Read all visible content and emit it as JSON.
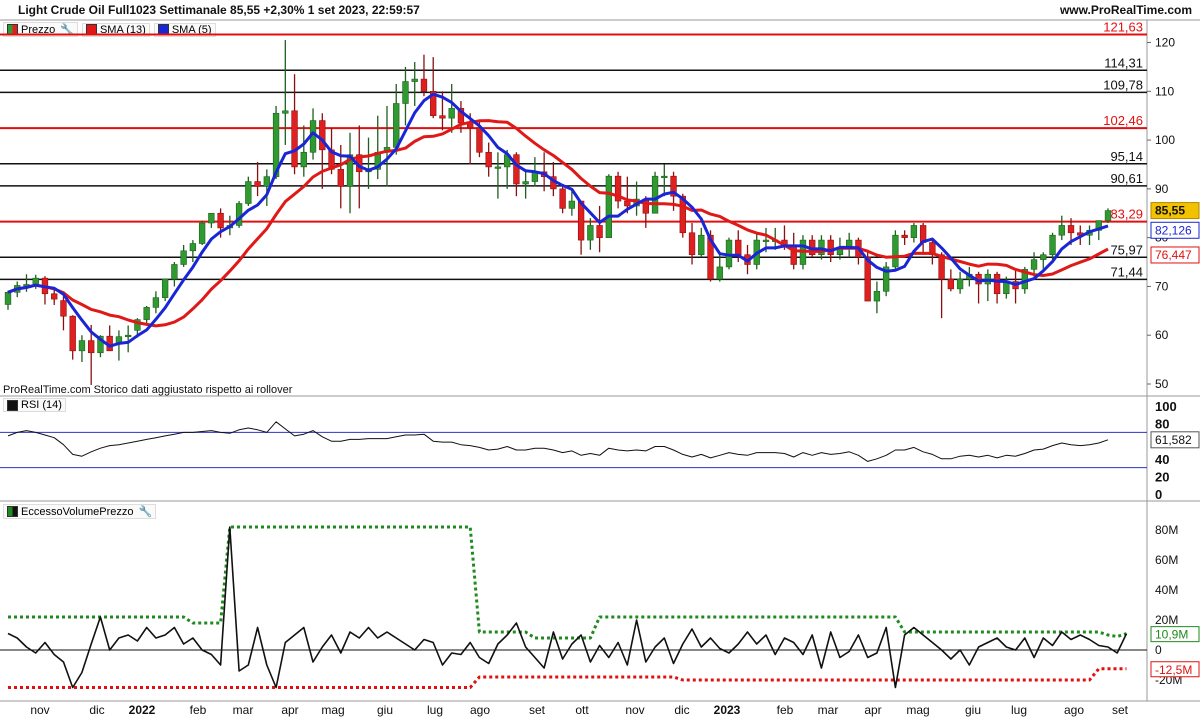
{
  "header": {
    "title": "Light Crude Oil Full1023 Settimanale 85,55 +2,30% 1 set 2023, 22:59:57",
    "site": "www.ProRealTime.com"
  },
  "legend": {
    "price_label": "Prezzo",
    "sma13_label": "SMA (13)",
    "sma5_label": "SMA (5)",
    "rsi_label": "RSI (14)",
    "volume_label": "EccessoVolumePrezzo"
  },
  "footnote": "ProRealTime.com  Storico dati aggiustato rispetto ai rollover",
  "colors": {
    "up": "#2f9a2f",
    "down": "#e02020",
    "sma13": "#e01818",
    "sma5": "#1a25d6",
    "red_level": "#e01010",
    "black_level": "#111111",
    "price_badge": "#f2c200",
    "green_dotted": "#1f8a1f",
    "red_dotted": "#e01010"
  },
  "chart_data": [
    {
      "type": "candlestick",
      "name": "Light Crude Oil Full1023 Settimanale",
      "ylim": [
        50,
        124
      ],
      "y_ticks": [
        50,
        60,
        70,
        80,
        90,
        100,
        110,
        120
      ],
      "x_tick_labels": [
        "nov",
        "dic",
        "2022",
        "feb",
        "mar",
        "apr",
        "mag",
        "giu",
        "lug",
        "ago",
        "set",
        "ott",
        "nov",
        "dic",
        "2023",
        "feb",
        "mar",
        "apr",
        "mag",
        "giu",
        "lug",
        "ago",
        "set"
      ],
      "levels": [
        {
          "value": 121.63,
          "label": "121,63",
          "color": "red"
        },
        {
          "value": 114.31,
          "label": "114,31",
          "color": "black"
        },
        {
          "value": 109.78,
          "label": "109,78",
          "color": "black"
        },
        {
          "value": 102.46,
          "label": "102,46",
          "color": "red"
        },
        {
          "value": 95.14,
          "label": "95,14",
          "color": "black"
        },
        {
          "value": 90.61,
          "label": "90,61",
          "color": "black"
        },
        {
          "value": 83.29,
          "label": "83,29",
          "color": "red"
        },
        {
          "value": 75.97,
          "label": "75,97",
          "color": "black"
        },
        {
          "value": 71.44,
          "label": "71,44",
          "color": "black"
        }
      ],
      "last_price": "85,55",
      "sma5_last": "82,126",
      "sma13_last": "76,447",
      "candles": [
        [
          66.3,
          69.1,
          65.2,
          68.8
        ],
        [
          68.8,
          71.0,
          67.8,
          70.2
        ],
        [
          70.2,
          72.5,
          68.9,
          70.4
        ],
        [
          70.4,
          72.4,
          69.5,
          71.7
        ],
        [
          71.7,
          72.1,
          66.3,
          68.5
        ],
        [
          68.5,
          69.5,
          66.2,
          67.4
        ],
        [
          67.1,
          68.0,
          61.0,
          63.9
        ],
        [
          63.9,
          64.1,
          55.0,
          56.8
        ],
        [
          56.8,
          60.0,
          54.5,
          58.9
        ],
        [
          58.9,
          62.1,
          49.8,
          56.4
        ],
        [
          56.4,
          60.0,
          55.5,
          59.8
        ],
        [
          59.8,
          62.0,
          57.8,
          56.8
        ],
        [
          58.2,
          61.0,
          54.8,
          59.7
        ],
        [
          59.7,
          62.0,
          56.5,
          60.0
        ],
        [
          61.0,
          63.5,
          59.5,
          63.2
        ],
        [
          63.2,
          66.0,
          62.5,
          65.7
        ],
        [
          65.7,
          69.0,
          64.5,
          67.7
        ],
        [
          67.7,
          71.5,
          67.0,
          71.5
        ],
        [
          71.5,
          75.0,
          70.0,
          74.5
        ],
        [
          74.5,
          78.5,
          74.0,
          77.3
        ],
        [
          77.3,
          79.5,
          75.0,
          78.8
        ],
        [
          78.8,
          83.5,
          78.5,
          83.0
        ],
        [
          83.0,
          85.0,
          82.0,
          85.0
        ],
        [
          85.0,
          86.0,
          80.0,
          82.0
        ],
        [
          82.0,
          84.5,
          80.5,
          82.5
        ],
        [
          82.5,
          87.5,
          82.0,
          87.0
        ],
        [
          87.0,
          92.5,
          86.5,
          91.5
        ],
        [
          91.5,
          95.5,
          88.5,
          90.5
        ],
        [
          90.5,
          94.0,
          86.5,
          92.5
        ],
        [
          92.5,
          107.0,
          92.0,
          105.5
        ],
        [
          105.5,
          120.5,
          99.0,
          106.0
        ],
        [
          106.0,
          113.5,
          93.0,
          94.5
        ],
        [
          94.5,
          103.0,
          92.5,
          97.5
        ],
        [
          97.5,
          106.5,
          96.0,
          104.0
        ],
        [
          104.0,
          105.5,
          90.0,
          98.0
        ],
        [
          98.0,
          102.5,
          93.0,
          94.0
        ],
        [
          94.0,
          99.0,
          86.0,
          90.5
        ],
        [
          90.5,
          101.5,
          85.0,
          97.0
        ],
        [
          97.0,
          103.0,
          86.0,
          93.5
        ],
        [
          93.5,
          100.5,
          90.0,
          94.0
        ],
        [
          94.0,
          105.0,
          92.0,
          97.5
        ],
        [
          97.5,
          107.0,
          90.5,
          98.5
        ],
        [
          98.5,
          111.5,
          97.0,
          107.5
        ],
        [
          107.5,
          115.0,
          103.0,
          112.0
        ],
        [
          112.0,
          116.0,
          107.0,
          112.5
        ],
        [
          112.5,
          117.5,
          109.0,
          110.0
        ],
        [
          110.0,
          117.0,
          104.5,
          105.0
        ],
        [
          105.0,
          110.0,
          102.0,
          104.5
        ],
        [
          104.5,
          111.5,
          101.5,
          106.5
        ],
        [
          106.5,
          108.0,
          101.5,
          103.5
        ],
        [
          103.5,
          105.5,
          95.0,
          102.5
        ],
        [
          102.5,
          104.0,
          96.5,
          97.5
        ],
        [
          97.5,
          99.5,
          92.5,
          94.5
        ],
        [
          94.5,
          97.5,
          88.0,
          94.5
        ],
        [
          94.5,
          98.0,
          90.0,
          97.0
        ],
        [
          97.0,
          97.5,
          88.5,
          91.0
        ],
        [
          91.0,
          94.0,
          88.0,
          91.5
        ],
        [
          91.5,
          96.5,
          90.5,
          93.5
        ],
        [
          93.5,
          97.5,
          89.5,
          92.5
        ],
        [
          92.5,
          95.5,
          88.5,
          90.0
        ],
        [
          90.0,
          91.0,
          85.0,
          86.0
        ],
        [
          86.0,
          89.5,
          84.5,
          87.5
        ],
        [
          87.5,
          87.5,
          76.5,
          79.5
        ],
        [
          79.5,
          84.0,
          77.5,
          82.5
        ],
        [
          82.5,
          86.5,
          77.0,
          80.0
        ],
        [
          80.0,
          93.0,
          80.0,
          92.6
        ],
        [
          92.6,
          93.5,
          86.0,
          87.5
        ],
        [
          87.5,
          92.5,
          85.0,
          86.5
        ],
        [
          86.5,
          91.5,
          84.5,
          87.9
        ],
        [
          87.9,
          88.5,
          82.0,
          85.0
        ],
        [
          85.0,
          93.5,
          85.0,
          92.6
        ],
        [
          92.6,
          95.0,
          88.5,
          92.6
        ],
        [
          92.6,
          93.5,
          85.5,
          88.5
        ],
        [
          88.5,
          89.0,
          80.0,
          81.0
        ],
        [
          81.0,
          83.0,
          74.5,
          76.5
        ],
        [
          76.5,
          82.0,
          76.0,
          80.5
        ],
        [
          80.5,
          81.5,
          71.0,
          71.5
        ],
        [
          71.5,
          77.0,
          71.0,
          74.0
        ],
        [
          74.0,
          80.0,
          73.5,
          79.5
        ],
        [
          79.5,
          81.5,
          75.0,
          76.5
        ],
        [
          76.5,
          78.5,
          72.5,
          74.5
        ],
        [
          74.5,
          81.0,
          73.5,
          79.5
        ],
        [
          79.5,
          82.0,
          77.0,
          79.5
        ],
        [
          79.5,
          82.0,
          77.5,
          79.5
        ],
        [
          79.5,
          82.5,
          77.5,
          78.5
        ],
        [
          78.5,
          81.0,
          73.5,
          74.5
        ],
        [
          74.5,
          80.5,
          73.5,
          79.5
        ],
        [
          79.5,
          80.5,
          76.0,
          76.5
        ],
        [
          76.5,
          80.5,
          75.5,
          79.5
        ],
        [
          79.5,
          80.5,
          75.0,
          76.5
        ],
        [
          76.5,
          80.0,
          75.5,
          78.0
        ],
        [
          78.0,
          81.0,
          76.0,
          79.5
        ],
        [
          79.5,
          80.0,
          74.5,
          76.0
        ],
        [
          76.0,
          77.5,
          67.5,
          67.0
        ],
        [
          67.0,
          71.0,
          64.5,
          69.0
        ],
        [
          69.0,
          75.0,
          68.0,
          74.0
        ],
        [
          74.0,
          81.5,
          73.5,
          80.5
        ],
        [
          80.5,
          81.5,
          78.5,
          80.0
        ],
        [
          80.0,
          83.0,
          79.0,
          82.5
        ],
        [
          82.5,
          83.0,
          76.5,
          79.0
        ],
        [
          79.0,
          80.0,
          74.5,
          76.5
        ],
        [
          76.5,
          77.0,
          63.5,
          71.5
        ],
        [
          71.5,
          73.5,
          69.0,
          69.5
        ],
        [
          69.5,
          73.0,
          68.5,
          71.5
        ],
        [
          71.5,
          74.0,
          70.0,
          72.5
        ],
        [
          72.5,
          73.0,
          66.5,
          70.5
        ],
        [
          70.5,
          73.5,
          67.0,
          72.5
        ],
        [
          72.5,
          73.0,
          66.5,
          68.5
        ],
        [
          68.5,
          72.0,
          67.5,
          71.0
        ],
        [
          71.0,
          73.5,
          66.5,
          69.5
        ],
        [
          69.5,
          74.0,
          68.5,
          73.5
        ],
        [
          73.5,
          77.0,
          72.0,
          75.5
        ],
        [
          75.5,
          77.0,
          73.5,
          76.5
        ],
        [
          76.5,
          81.0,
          75.5,
          80.5
        ],
        [
          80.5,
          84.5,
          79.5,
          82.5
        ],
        [
          82.5,
          84.0,
          78.5,
          81.0
        ],
        [
          81.0,
          82.5,
          78.5,
          80.5
        ],
        [
          80.5,
          82.5,
          78.5,
          81.5
        ],
        [
          81.5,
          83.5,
          79.5,
          83.5
        ],
        [
          83.5,
          86.0,
          83.0,
          85.55
        ]
      ]
    },
    {
      "type": "line",
      "name": "RSI (14)",
      "ylim": [
        0,
        100
      ],
      "y_ticks": [
        0,
        20,
        40,
        60,
        80,
        100
      ],
      "bands": [
        30,
        70
      ],
      "last_value": "61,582",
      "values": [
        66,
        70,
        72,
        70,
        67,
        64,
        56,
        45,
        43,
        48,
        52,
        55,
        56,
        58,
        60,
        62,
        64,
        66,
        68,
        70,
        70,
        71,
        72,
        70,
        69,
        73,
        75,
        73,
        70,
        82,
        74,
        66,
        68,
        72,
        65,
        60,
        60,
        62,
        62,
        63,
        63,
        63,
        65,
        67,
        67,
        68,
        60,
        59,
        59,
        56,
        55,
        53,
        50,
        51,
        54,
        50,
        50,
        52,
        52,
        50,
        47,
        49,
        44,
        46,
        44,
        52,
        50,
        49,
        50,
        49,
        54,
        54,
        50,
        45,
        42,
        45,
        41,
        44,
        47,
        45,
        44,
        47,
        47,
        47,
        46,
        42,
        47,
        44,
        47,
        45,
        46,
        48,
        44,
        37,
        40,
        44,
        50,
        50,
        53,
        48,
        45,
        40,
        40,
        43,
        44,
        42,
        44,
        41,
        44,
        43,
        46,
        50,
        51,
        55,
        58,
        56,
        55,
        56,
        58,
        61.6
      ]
    },
    {
      "type": "line",
      "name": "EccessoVolumePrezzo",
      "ylim": [
        -27,
        93
      ],
      "y_ticks": [
        -20,
        0,
        20,
        40,
        60,
        80
      ],
      "y_tick_labels": [
        "-20M",
        "0",
        "20M",
        "40M",
        "60M",
        "80M"
      ],
      "last_value": "10,9M",
      "upper_band_label": "10,9M",
      "lower_band_label": "-12,5M",
      "values": [
        11,
        8,
        2,
        -2,
        5,
        -3,
        -8,
        -25,
        -15,
        4,
        22,
        0,
        8,
        10,
        6,
        15,
        8,
        10,
        15,
        4,
        8,
        0,
        -3,
        -10,
        82,
        -14,
        -10,
        15,
        -10,
        -25,
        5,
        10,
        15,
        -8,
        2,
        10,
        -2,
        12,
        8,
        15,
        8,
        12,
        8,
        4,
        0,
        7,
        5,
        -10,
        -2,
        -3,
        5,
        -5,
        -9,
        4,
        10,
        18,
        2,
        -5,
        -12,
        12,
        -6,
        4,
        10,
        -8,
        3,
        -5,
        5,
        -10,
        20,
        -8,
        2,
        8,
        -9,
        4,
        14,
        2,
        8,
        1,
        -2,
        4,
        12,
        4,
        10,
        -3,
        8,
        5,
        -3,
        10,
        -12,
        12,
        -5,
        -1,
        10,
        -5,
        -2,
        15,
        -25,
        10,
        15,
        10,
        5,
        0,
        -6,
        0,
        -10,
        2,
        5,
        8,
        2,
        0,
        8,
        -5,
        8,
        3,
        12,
        7,
        10,
        7,
        3,
        2,
        -2,
        10.9
      ],
      "upper_band": [
        22,
        22,
        22,
        22,
        22,
        22,
        22,
        22,
        22,
        22,
        22,
        22,
        22,
        22,
        22,
        22,
        22,
        22,
        22,
        22,
        18,
        18,
        18,
        18,
        82,
        82,
        82,
        82,
        82,
        82,
        82,
        82,
        82,
        82,
        82,
        82,
        82,
        82,
        82,
        82,
        82,
        82,
        82,
        82,
        82,
        82,
        82,
        82,
        82,
        82,
        82,
        12,
        12,
        12,
        12,
        12,
        12,
        8,
        8,
        8,
        8,
        8,
        8,
        8,
        22,
        22,
        22,
        22,
        22,
        22,
        22,
        22,
        22,
        22,
        22,
        22,
        22,
        22,
        22,
        22,
        22,
        22,
        22,
        22,
        22,
        22,
        22,
        22,
        22,
        22,
        22,
        22,
        22,
        22,
        22,
        22,
        22,
        12,
        12,
        12,
        12,
        12,
        12,
        12,
        12,
        12,
        12,
        12,
        12,
        12,
        12,
        12,
        12,
        12,
        12,
        12,
        12,
        12,
        12,
        10,
        9,
        10.9
      ],
      "lower_band": [
        -25,
        -25,
        -25,
        -25,
        -25,
        -25,
        -25,
        -25,
        -25,
        -25,
        -25,
        -25,
        -25,
        -25,
        -25,
        -25,
        -25,
        -25,
        -25,
        -25,
        -25,
        -25,
        -25,
        -25,
        -25,
        -25,
        -25,
        -25,
        -25,
        -25,
        -25,
        -25,
        -25,
        -25,
        -25,
        -25,
        -25,
        -25,
        -25,
        -25,
        -25,
        -25,
        -25,
        -25,
        -25,
        -25,
        -25,
        -25,
        -25,
        -25,
        -25,
        -18,
        -18,
        -18,
        -18,
        -18,
        -18,
        -18,
        -18,
        -18,
        -18,
        -18,
        -18,
        -18,
        -18,
        -18,
        -18,
        -18,
        -18,
        -18,
        -18,
        -18,
        -18,
        -20,
        -20,
        -20,
        -20,
        -20,
        -20,
        -20,
        -20,
        -20,
        -20,
        -20,
        -20,
        -20,
        -20,
        -20,
        -20,
        -20,
        -20,
        -20,
        -20,
        -20,
        -20,
        -20,
        -20,
        -20,
        -20,
        -20,
        -20,
        -20,
        -20,
        -20,
        -20,
        -20,
        -20,
        -20,
        -20,
        -20,
        -20,
        -20,
        -20,
        -20,
        -20,
        -20,
        -20,
        -20,
        -12.5,
        -12.5,
        -12.5,
        -12.5
      ]
    }
  ]
}
